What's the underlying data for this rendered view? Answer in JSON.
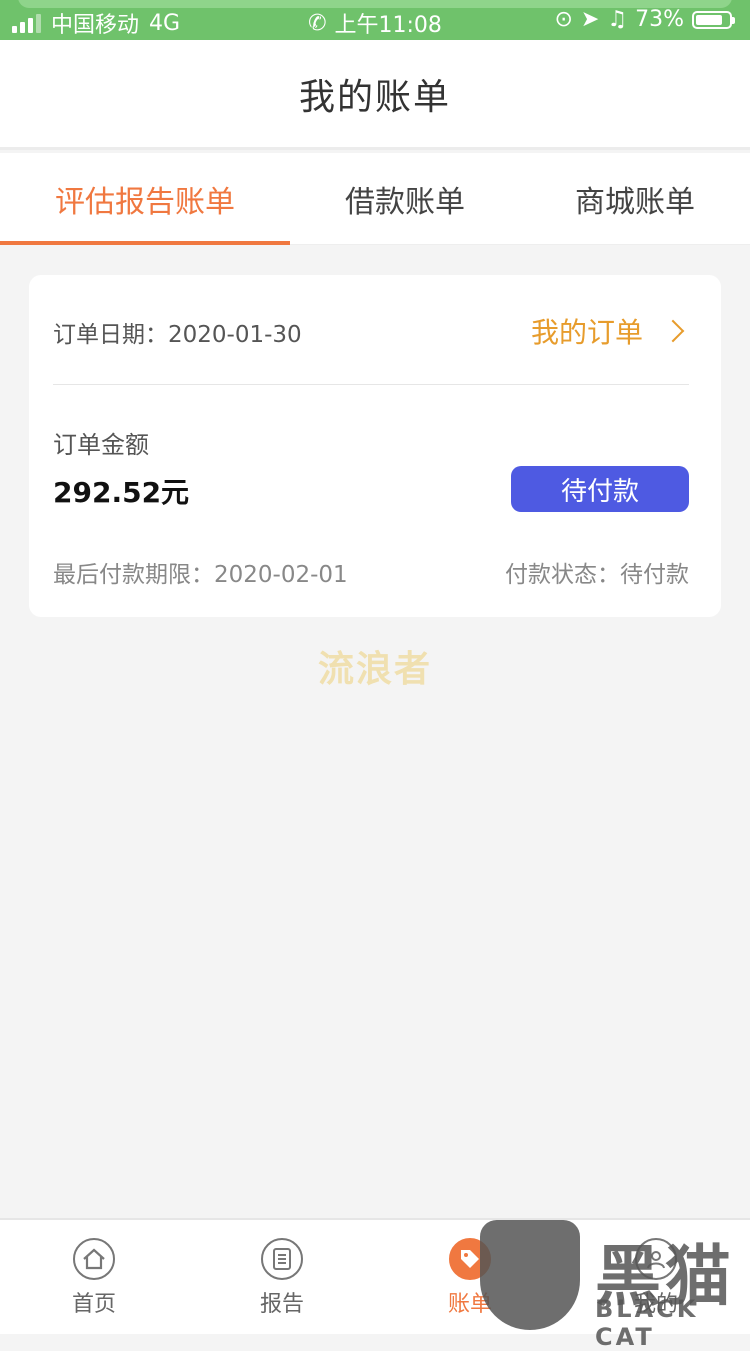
{
  "status_bar": {
    "carrier": "中国移动",
    "network": "4G",
    "time": "上午11:08",
    "battery": "73%"
  },
  "nav": {
    "title": "我的账单"
  },
  "tabs": [
    {
      "label": "评估报告账单",
      "active": true
    },
    {
      "label": "借款账单",
      "active": false
    },
    {
      "label": "商城账单",
      "active": false
    }
  ],
  "order": {
    "date_text": "订单日期：2020-01-30",
    "my_order_link": "我的订单",
    "amount_label": "订单金额",
    "amount_value": "292.52元",
    "pay_button": "待付款",
    "deadline_text": "最后付款期限：2020-02-01",
    "status_text": "付款状态：待付款"
  },
  "watermark": "流浪者",
  "bottom_nav": [
    {
      "label": "首页",
      "icon": "home-icon",
      "active": false
    },
    {
      "label": "报告",
      "icon": "report-icon",
      "active": false
    },
    {
      "label": "账单",
      "icon": "tag-icon",
      "active": true
    },
    {
      "label": "我的",
      "icon": "user-icon",
      "active": false
    }
  ],
  "logo": {
    "cn": "黑猫",
    "en": "BLACK CAT"
  },
  "colors": {
    "accent": "#f07840",
    "link": "#e79c2c",
    "button": "#4e5ae2",
    "status_bar": "#6fc26b"
  }
}
